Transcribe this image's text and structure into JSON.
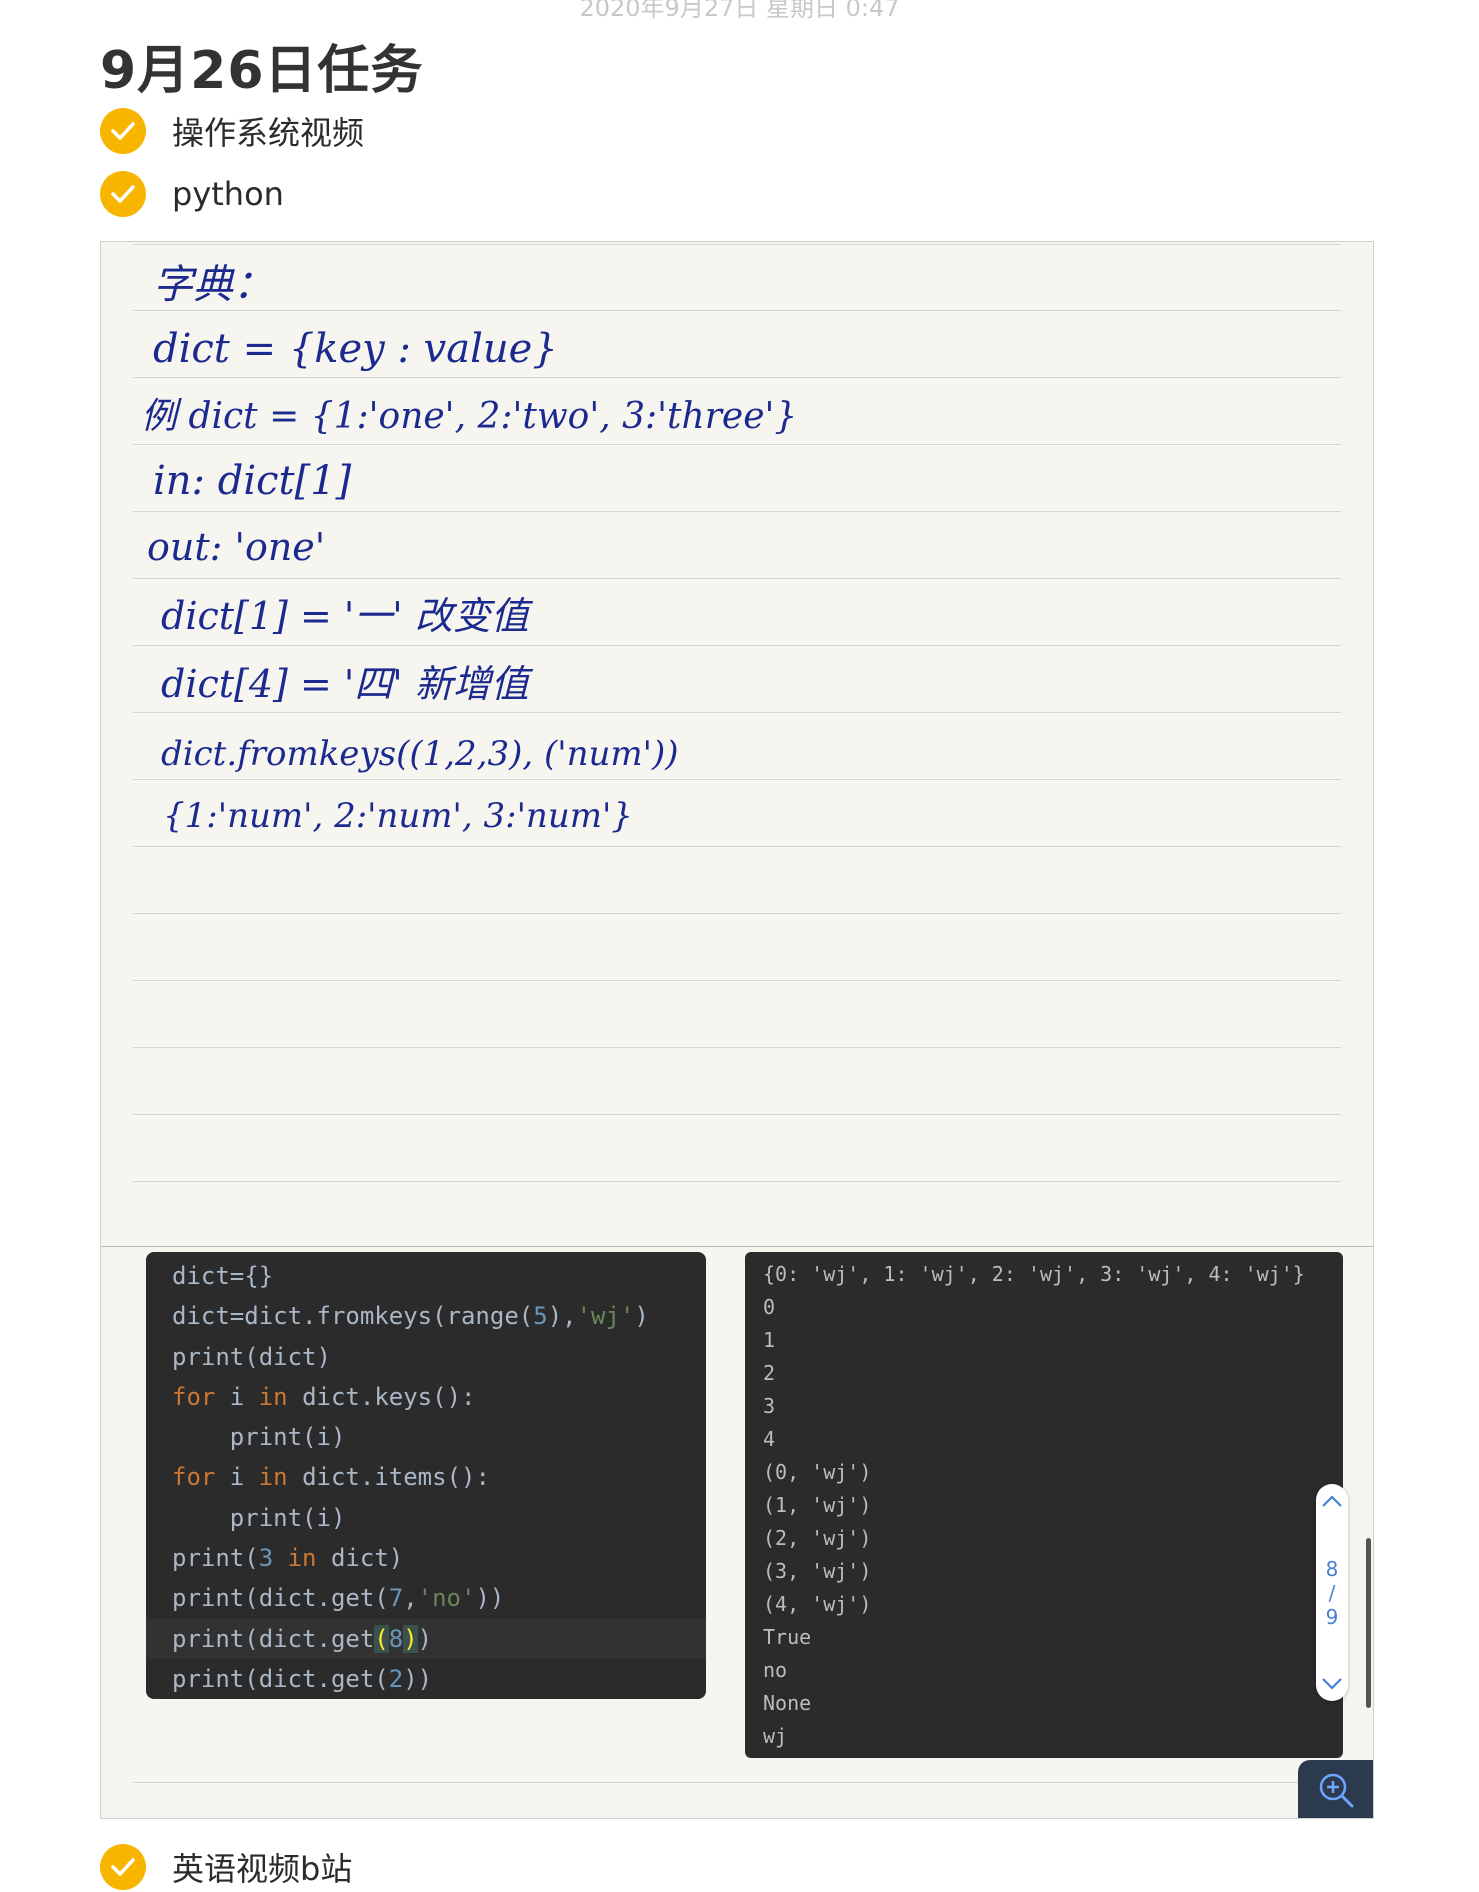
{
  "header": {
    "timestamp": "2020年9月27日 星期日 0:47",
    "title": "9月26日任务"
  },
  "tasks": [
    {
      "label": "操作系统视频",
      "done": true
    },
    {
      "label": "python",
      "done": true
    },
    {
      "label": "英语视频b站",
      "done": true
    }
  ],
  "handwriting": [
    "字典：",
    "dict = {key : value}",
    "例 dict = {1:'one', 2:'two', 3:'three'}",
    "in: dict[1]",
    "out: 'one'",
    "dict[1] = '一'   改变值",
    "dict[4] = '四'   新增值",
    "dict.fromkeys((1,2,3), ('num'))",
    "{1:'num', 2:'num', 3:'num'}"
  ],
  "code": [
    "dict={}",
    "dict=dict.fromkeys(range(5),'wj')",
    "print(dict)",
    "for i in dict.keys():",
    "    print(i)",
    "for i in dict.items():",
    "    print(i)",
    "print(3 in dict)",
    "print(dict.get(7,'no'))",
    "print(dict.get(8))",
    "print(dict.get(2))"
  ],
  "output": [
    "{0: 'wj', 1: 'wj', 2: 'wj', 3: 'wj', 4: 'wj'}",
    "0",
    "1",
    "2",
    "3",
    "4",
    "(0, 'wj')",
    "(1, 'wj')",
    "(2, 'wj')",
    "(3, 'wj')",
    "(4, 'wj')",
    "True",
    "no",
    "None",
    "wj"
  ],
  "pager": {
    "current": "8",
    "separator": "/",
    "total": "9"
  },
  "colors": {
    "check": "#f7b500",
    "ink": "#1c2a8f",
    "code_bg": "#2b2b2b",
    "keyword": "#cc7832",
    "number": "#6897bb",
    "string": "#6a8759"
  }
}
